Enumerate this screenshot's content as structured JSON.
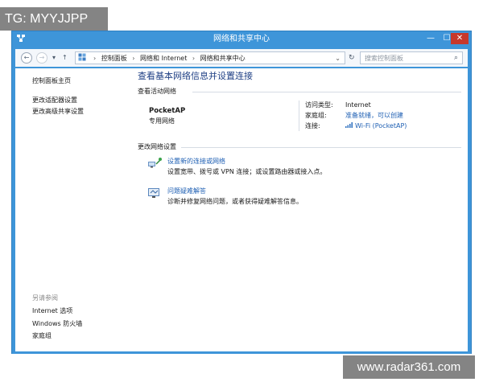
{
  "watermarks": {
    "top": "TG: MYYJJPP",
    "bottom": "www.radar361.com"
  },
  "window": {
    "title": "网络和共享中心",
    "controls": {
      "minimize": "—",
      "maximize": "☐",
      "close": "✕"
    }
  },
  "navbar": {
    "back": "←",
    "forward": "→",
    "recent": "▾",
    "up": "↑",
    "breadcrumbs": [
      "控制面板",
      "网络和 Internet",
      "网络和共享中心"
    ],
    "separator": "›",
    "dropdown": "⌄",
    "refresh": "↻",
    "search_placeholder": "搜索控制面板",
    "search_icon": "⌕"
  },
  "left_pane": {
    "home_link": "控制面板主页",
    "links": [
      "更改适配器设置",
      "更改高级共享设置"
    ],
    "see_also_label": "另请参阅",
    "see_also_links": [
      "Internet 选项",
      "Windows 防火墙",
      "家庭组"
    ]
  },
  "main": {
    "title": "查看基本网络信息并设置连接",
    "active_networks_label": "查看活动网络",
    "network": {
      "name": "PocketAP",
      "type": "专用网络",
      "access_type_label": "访问类型:",
      "access_type_value": "Internet",
      "homegroup_label": "家庭组:",
      "homegroup_value": "准备就绪，可以创建",
      "connection_label": "连接:",
      "connection_value": "Wi-Fi (PocketAP)",
      "connection_icon": "wifi-signal-icon"
    },
    "change_settings_label": "更改网络设置",
    "tasks": [
      {
        "link": "设置新的连接或网络",
        "description": "设置宽带、拨号或 VPN 连接；或设置路由器或接入点。",
        "icon": "new-connection-icon"
      },
      {
        "link": "问题疑难解答",
        "description": "诊断并修复网络问题，或者获得疑难解答信息。",
        "icon": "troubleshoot-icon"
      }
    ]
  },
  "colors": {
    "window_frame": "#3e95d9",
    "close_button": "#c7382c",
    "title_text": "#1e3f84",
    "link": "#1e5fb3"
  }
}
